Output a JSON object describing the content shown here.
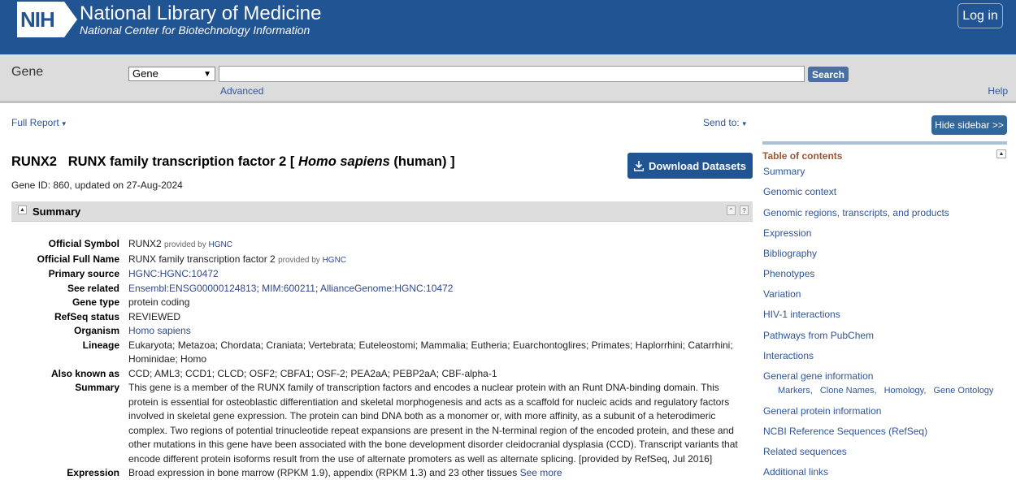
{
  "header": {
    "logo": "NIH",
    "title": "National Library of Medicine",
    "subtitle": "National Center for Biotechnology Information",
    "login": "Log in"
  },
  "search": {
    "db_label": "Gene",
    "db_selected": "Gene",
    "query": "",
    "button": "Search",
    "advanced": "Advanced",
    "help": "Help"
  },
  "report": {
    "format": "Full Report",
    "send_to": "Send to:",
    "symbol": "RUNX2",
    "name_prefix": "RUNX family transcription factor 2 [",
    "species": "Homo sapiens",
    "name_suffix": "(human) ]",
    "gene_id": "Gene ID: 860, updated on 27-Aug-2024",
    "download": "Download Datasets"
  },
  "summary_section": {
    "title": "Summary",
    "rows": {
      "official_symbol": {
        "k": "Official Symbol",
        "v": "RUNX2",
        "pre": "provided by",
        "src": "HGNC"
      },
      "official_full_name": {
        "k": "Official Full Name",
        "v": "RUNX family transcription factor 2",
        "pre": "provided by",
        "src": "HGNC"
      },
      "primary_source": {
        "k": "Primary source",
        "v": "HGNC:HGNC:10472"
      },
      "see_related": {
        "k": "See related",
        "l1": "Ensembl:ENSG00000124813",
        "l2": "MIM:600211",
        "l3": "AllianceGenome:HGNC:10472",
        "sep": ";"
      },
      "gene_type": {
        "k": "Gene type",
        "v": "protein coding"
      },
      "refseq_status": {
        "k": "RefSeq status",
        "v": "REVIEWED"
      },
      "organism": {
        "k": "Organism",
        "v": "Homo sapiens"
      },
      "lineage": {
        "k": "Lineage",
        "v": "Eukaryota; Metazoa; Chordata; Craniata; Vertebrata; Euteleostomi; Mammalia; Eutheria; Euarchontoglires; Primates; Haplorrhini; Catarrhini; Hominidae; Homo"
      },
      "aka": {
        "k": "Also known as",
        "v": "CCD; AML3; CCD1; CLCD; OSF2; CBFA1; OSF-2; PEA2aA; PEBP2aA; CBF-alpha-1"
      },
      "summary": {
        "k": "Summary",
        "v": "This gene is a member of the RUNX family of transcription factors and encodes a nuclear protein with an Runt DNA-binding domain. This protein is essential for osteoblastic differentiation and skeletal morphogenesis and acts as a scaffold for nucleic acids and regulatory factors involved in skeletal gene expression. The protein can bind DNA both as a monomer or, with more affinity, as a subunit of a heterodimeric complex. Two regions of potential trinucleotide repeat expansions are present in the N-terminal region of the encoded protein, and these and other mutations in this gene have been associated with the bone development disorder cleidocranial dysplasia (CCD). Transcript variants that encode different protein isoforms result from the use of alternate promoters as well as alternate splicing. [provided by RefSeq, Jul 2016]"
      },
      "expression": {
        "k": "Expression",
        "v": "Broad expression in bone marrow (RPKM 1.9), appendix (RPKM 1.3) and 23 other tissues",
        "link": "See more"
      }
    }
  },
  "sidebar": {
    "hide": "Hide sidebar >>",
    "toc_title": "Table of contents",
    "items": {
      "i0": "Summary",
      "i1": "Genomic context",
      "i2": "Genomic regions, transcripts, and products",
      "i3": "Expression",
      "i4": "Bibliography",
      "i5": "Phenotypes",
      "i6": "Variation",
      "i7": "HIV-1 interactions",
      "i8": "Pathways from PubChem",
      "i9": "Interactions",
      "i10": "General gene information",
      "i11": "General protein information",
      "i12": "NCBI Reference Sequences (RefSeq)",
      "i13": "Related sequences",
      "i14": "Additional links"
    },
    "sub": {
      "s0": "Markers,",
      "s1": "Clone Names,",
      "s2": "Homology,",
      "s3": "Gene Ontology"
    }
  },
  "colors": {
    "header_bg": "#205493",
    "link": "#2f5597",
    "toc_title": "#985735"
  }
}
